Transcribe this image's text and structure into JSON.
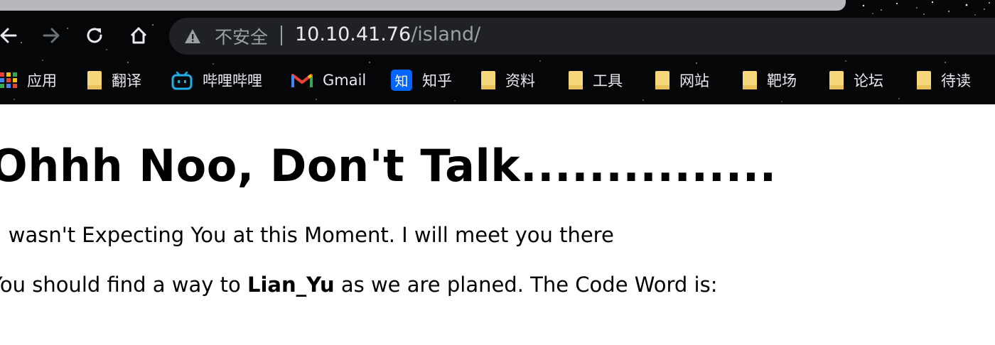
{
  "browser": {
    "insecure_label": "不安全",
    "url_host": "10.10.41.76",
    "url_path": "/island/",
    "bookmarks": [
      {
        "label": "应用",
        "icon": "apps-grid-icon"
      },
      {
        "label": "翻译",
        "icon": "folder-icon"
      },
      {
        "label": "哔哩哔哩",
        "icon": "bilibili-icon"
      },
      {
        "label": "Gmail",
        "icon": "gmail-icon"
      },
      {
        "label": "知乎",
        "icon": "zhihu-icon"
      },
      {
        "label": "资料",
        "icon": "folder-icon"
      },
      {
        "label": "工具",
        "icon": "folder-icon"
      },
      {
        "label": "网站",
        "icon": "folder-icon"
      },
      {
        "label": "靶场",
        "icon": "folder-icon"
      },
      {
        "label": "论坛",
        "icon": "folder-icon"
      },
      {
        "label": "待读",
        "icon": "folder-icon"
      }
    ],
    "zhihu_glyph": "知"
  },
  "page": {
    "heading": "Ohhh Noo, Don't Talk...............",
    "para1": "I wasn't Expecting You at this Moment. I will meet you there",
    "para2_prefix": "You should find a way to ",
    "para2_bold": "Lian_Yu",
    "para2_suffix": " as we are planed. The Code Word is:"
  },
  "colors": {
    "chrome_bg": "#050608",
    "omnibox_bg": "#202124",
    "folder": "#f6d87a",
    "bilibili": "#23ade5",
    "zhihu": "#0066ff"
  }
}
